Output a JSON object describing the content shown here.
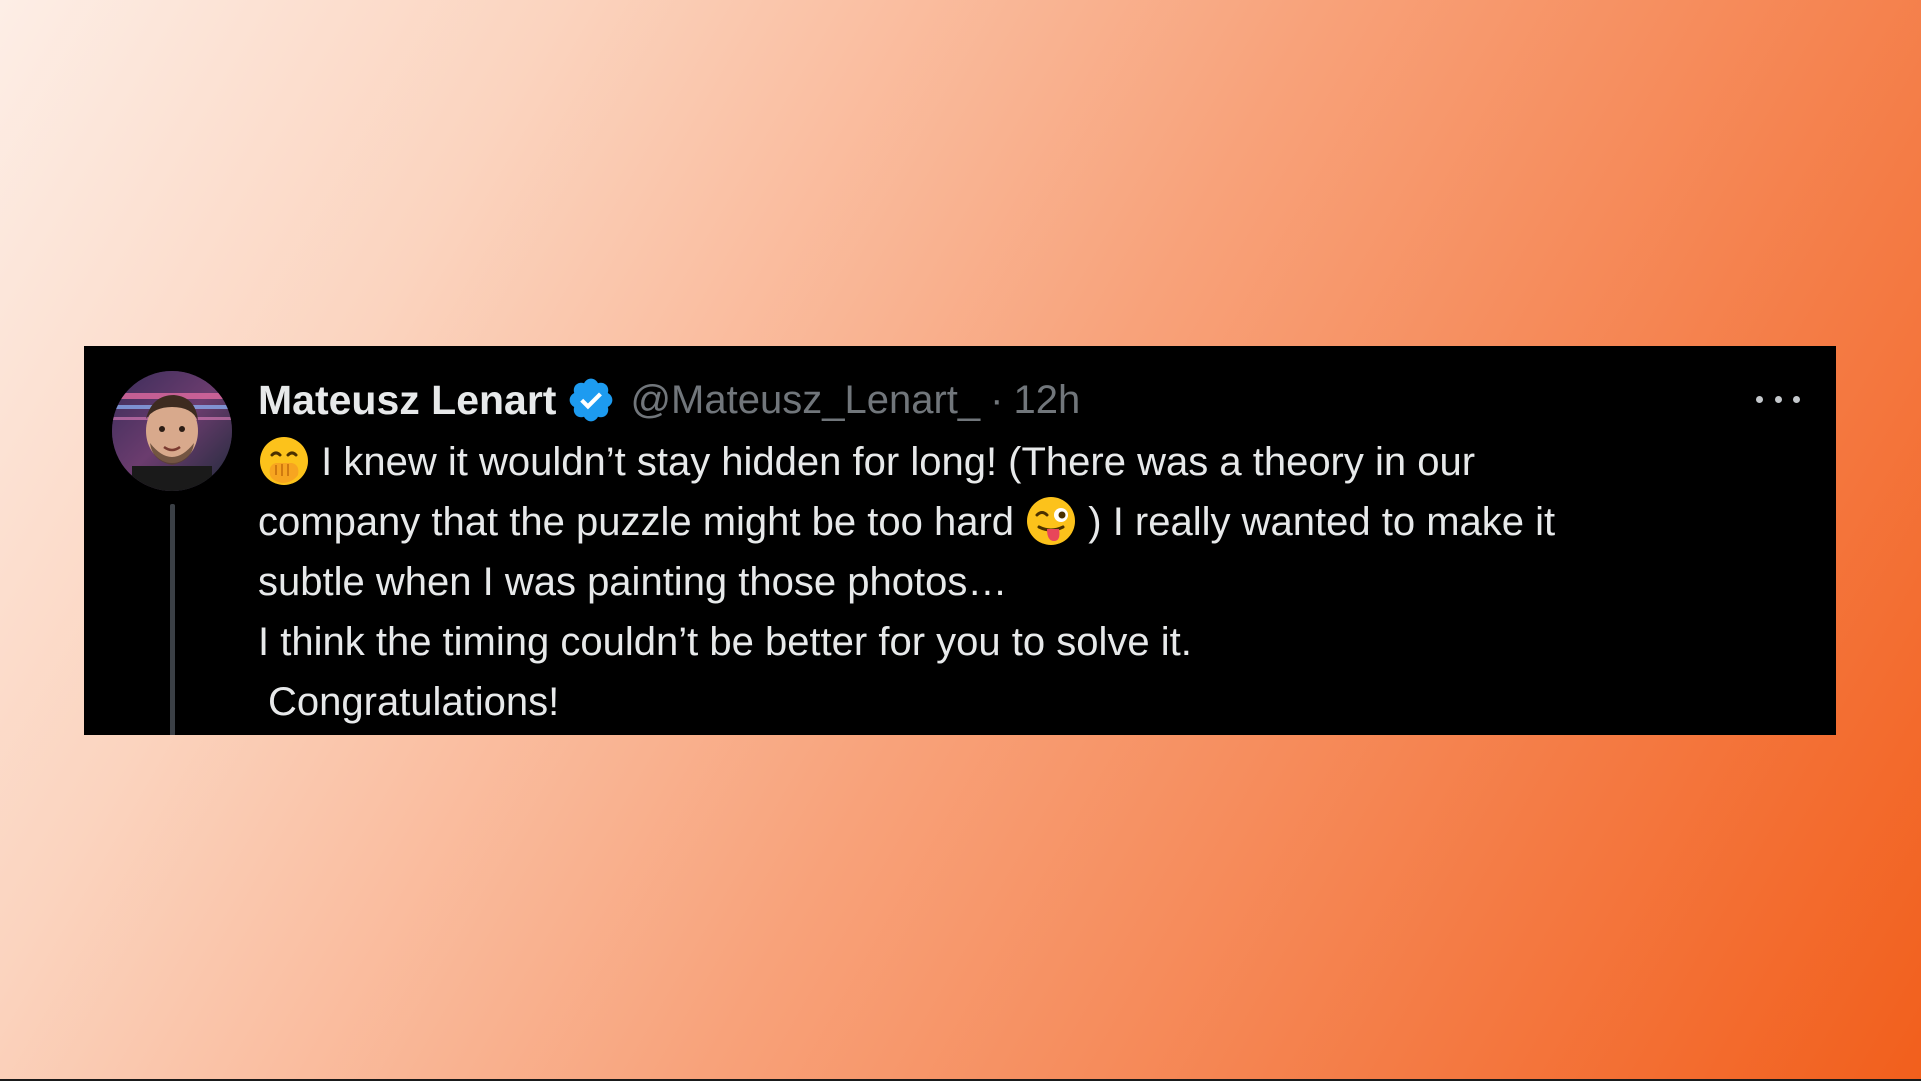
{
  "post": {
    "author": {
      "display_name": "Mateusz Lenart",
      "handle": "@Mateusz_Lenart_",
      "verified": true
    },
    "separator": "·",
    "timestamp": "12h",
    "more_icon": "more-horizontal-icon",
    "body": {
      "line1_text": "I knew it wouldn’t stay hidden for long! (There was a theory in our",
      "line1_emoji": "hand-over-mouth-emoji",
      "line2_text_before": "company that the puzzle might be too hard",
      "line2_emoji": "winking-face-with-tongue-emoji",
      "line2_text_after": ") I really wanted to make it",
      "line3_text": "subtle when I was painting those photos…",
      "line4_text": "I think the timing couldn’t be better for you to solve it.",
      "line5_text": "Congratulations!"
    }
  },
  "colors": {
    "card_bg": "#000000",
    "text": "#e7e9ea",
    "muted": "#71767b",
    "verified": "#1d9bf0",
    "background_gradient": [
      "#fdeee6",
      "#f8a27a",
      "#f25f1c"
    ]
  }
}
